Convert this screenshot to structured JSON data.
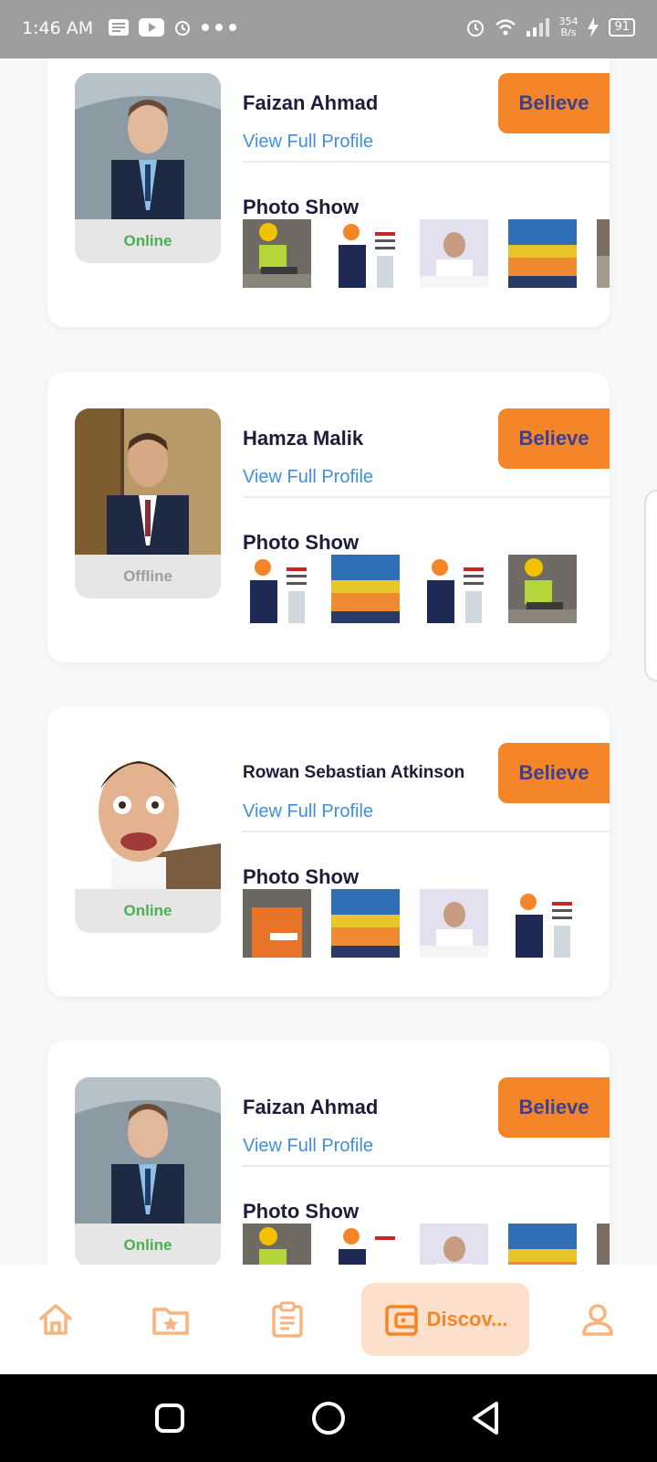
{
  "status_bar": {
    "time": "1:46 AM",
    "net_speed_value": "354",
    "net_speed_unit": "B/s",
    "battery": "91"
  },
  "believe_label": "Believe",
  "view_profile_label": "View Full Profile",
  "photo_show_label": "Photo Show",
  "cards": [
    {
      "name": "Faizan Ahmad",
      "status": "Online"
    },
    {
      "name": "Hamza Malik",
      "status": "Offline"
    },
    {
      "name": "Rowan Sebastian Atkinson",
      "status": "Online"
    },
    {
      "name": "Faizan Ahmad",
      "status": "Online"
    }
  ],
  "bottom_nav": {
    "items": [
      {
        "icon": "home-icon"
      },
      {
        "icon": "folder-star-icon"
      },
      {
        "icon": "clipboard-icon"
      },
      {
        "icon": "wallet-icon",
        "label": "Discov..."
      },
      {
        "icon": "person-icon"
      }
    ]
  },
  "colors": {
    "accent": "#f48529",
    "accent_soft": "#fde0cc",
    "link": "#3f8fe0",
    "online": "#4caf50",
    "offline": "#9e9e9e",
    "button_text": "#3d3f8f"
  }
}
